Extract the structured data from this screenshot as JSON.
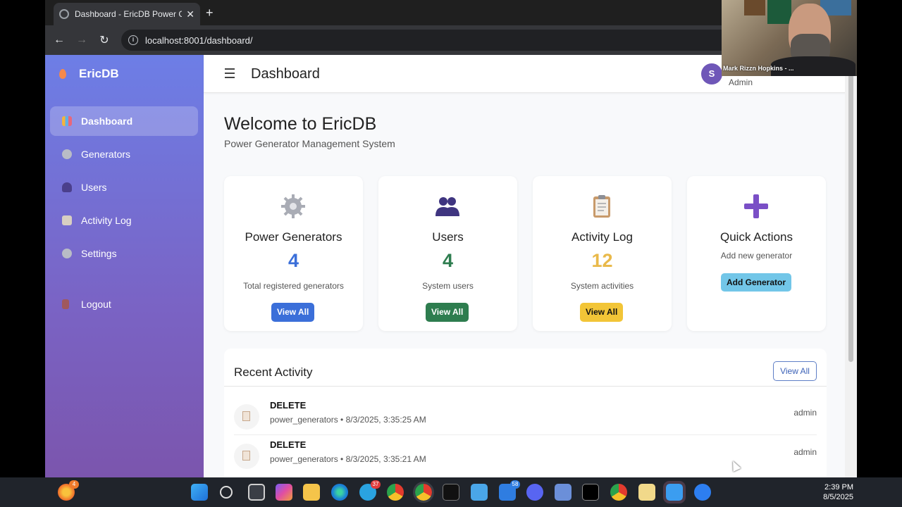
{
  "browser": {
    "tab_title": "Dashboard - EricDB Power Gen",
    "url": "localhost:8001/dashboard/"
  },
  "sidebar": {
    "brand": "EricDB",
    "items": [
      {
        "label": "Dashboard",
        "icon": "chart-icon",
        "active": true
      },
      {
        "label": "Generators",
        "icon": "gear-icon",
        "active": false
      },
      {
        "label": "Users",
        "icon": "users-icon",
        "active": false
      },
      {
        "label": "Activity Log",
        "icon": "clipboard-icon",
        "active": false
      },
      {
        "label": "Settings",
        "icon": "gear-icon",
        "active": false
      }
    ],
    "logout": "Logout"
  },
  "header": {
    "title": "Dashboard",
    "avatar_initial": "S",
    "role": "Admin"
  },
  "welcome": {
    "title": "Welcome to EricDB",
    "subtitle": "Power Generator Management System"
  },
  "cards": [
    {
      "icon": "gear-icon",
      "title": "Power Generators",
      "value": "4",
      "desc": "Total registered generators",
      "button": "View All",
      "value_color": "#3b6fd9",
      "button_color": "#3b6fd9"
    },
    {
      "icon": "users-icon",
      "title": "Users",
      "value": "4",
      "desc": "System users",
      "button": "View All",
      "value_color": "#2e7d4f",
      "button_color": "#2e7d4f"
    },
    {
      "icon": "clipboard-icon",
      "title": "Activity Log",
      "value": "12",
      "desc": "System activities",
      "button": "View All",
      "value_color": "#e9b94a",
      "button_color": "#f2c537"
    },
    {
      "icon": "plus-icon",
      "title": "Quick Actions",
      "desc": "Add new generator",
      "button": "Add Generator",
      "button_color": "#72c6e8"
    }
  ],
  "recent": {
    "title": "Recent Activity",
    "view_all": "View All",
    "items": [
      {
        "action": "DELETE",
        "meta": "power_generators • 8/3/2025, 3:35:25 AM",
        "user": "admin"
      },
      {
        "action": "DELETE",
        "meta": "power_generators • 8/3/2025, 3:35:21 AM",
        "user": "admin"
      }
    ]
  },
  "webcam": {
    "name": "Mark Rizzn Hopkins - ..."
  },
  "taskbar": {
    "time": "2:39 PM",
    "date": "8/5/2025",
    "badges": {
      "firefox": "4",
      "telegram": "37",
      "mail": "58"
    }
  }
}
